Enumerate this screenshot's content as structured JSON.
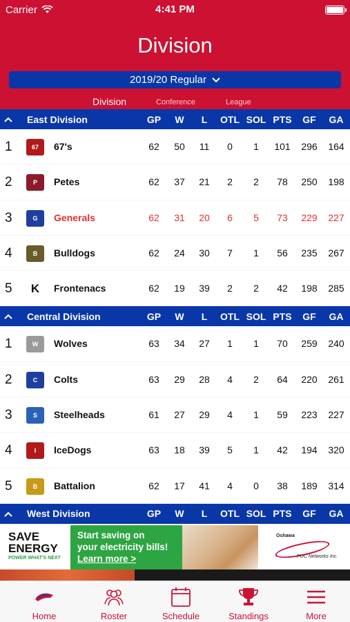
{
  "status": {
    "carrier": "Carrier",
    "time": "4:41 PM"
  },
  "header": {
    "title": "Division",
    "season": "2019/20 Regular"
  },
  "tabs": [
    {
      "label": "Division"
    },
    {
      "label": "Conference"
    },
    {
      "label": "League"
    }
  ],
  "columns": [
    "GP",
    "W",
    "L",
    "OTL",
    "SOL",
    "PTS",
    "GF",
    "GA"
  ],
  "divisions": [
    {
      "name": "East Division",
      "teams": [
        {
          "rank": "1",
          "team": "67's",
          "logo_color": "#b01a1a",
          "logo_text": "67",
          "gp": "62",
          "w": "50",
          "l": "11",
          "otl": "0",
          "sol": "1",
          "pts": "101",
          "gf": "296",
          "ga": "164"
        },
        {
          "rank": "2",
          "team": "Petes",
          "logo_color": "#8b1a2b",
          "logo_text": "P",
          "gp": "62",
          "w": "37",
          "l": "21",
          "otl": "2",
          "sol": "2",
          "pts": "78",
          "gf": "250",
          "ga": "198"
        },
        {
          "rank": "3",
          "team": "Generals",
          "logo_color": "#1f3fa0",
          "logo_text": "G",
          "gp": "62",
          "w": "31",
          "l": "20",
          "otl": "6",
          "sol": "5",
          "pts": "73",
          "gf": "229",
          "ga": "227"
        },
        {
          "rank": "4",
          "team": "Bulldogs",
          "logo_color": "#6b5a2a",
          "logo_text": "B",
          "gp": "62",
          "w": "24",
          "l": "30",
          "otl": "7",
          "sol": "1",
          "pts": "56",
          "gf": "235",
          "ga": "267"
        },
        {
          "rank": "5",
          "team": "Frontenacs",
          "logo_color": "#f2c300",
          "logo_text": "K",
          "gp": "62",
          "w": "19",
          "l": "39",
          "otl": "2",
          "sol": "2",
          "pts": "42",
          "gf": "198",
          "ga": "285"
        }
      ]
    },
    {
      "name": "Central Division",
      "teams": [
        {
          "rank": "1",
          "team": "Wolves",
          "logo_color": "#9a9a9a",
          "logo_text": "W",
          "gp": "63",
          "w": "34",
          "l": "27",
          "otl": "1",
          "sol": "1",
          "pts": "70",
          "gf": "259",
          "ga": "240"
        },
        {
          "rank": "2",
          "team": "Colts",
          "logo_color": "#1f3fa0",
          "logo_text": "C",
          "gp": "63",
          "w": "29",
          "l": "28",
          "otl": "4",
          "sol": "2",
          "pts": "64",
          "gf": "220",
          "ga": "261"
        },
        {
          "rank": "3",
          "team": "Steelheads",
          "logo_color": "#2a62b8",
          "logo_text": "S",
          "gp": "61",
          "w": "27",
          "l": "29",
          "otl": "4",
          "sol": "1",
          "pts": "59",
          "gf": "223",
          "ga": "227"
        },
        {
          "rank": "4",
          "team": "IceDogs",
          "logo_color": "#b01a1a",
          "logo_text": "I",
          "gp": "63",
          "w": "18",
          "l": "39",
          "otl": "5",
          "sol": "1",
          "pts": "42",
          "gf": "194",
          "ga": "320"
        },
        {
          "rank": "5",
          "team": "Battalion",
          "logo_color": "#c79a1a",
          "logo_text": "B",
          "gp": "62",
          "w": "17",
          "l": "41",
          "otl": "4",
          "sol": "0",
          "pts": "38",
          "gf": "189",
          "ga": "314"
        }
      ]
    },
    {
      "name": "West Division",
      "teams": []
    }
  ],
  "ad": {
    "brand_line1": "SAVE",
    "brand_line2": "ENERGY",
    "brand_tagline": "POWER WHAT'S NEXT",
    "cta_line1": "Start saving on",
    "cta_line2": "your electricity bills!",
    "cta_link": "Learn more >",
    "sponsor_top": "Oshawa",
    "sponsor_bottom": "PUC Networks Inc."
  },
  "tabbar": [
    {
      "label": "Home"
    },
    {
      "label": "Roster"
    },
    {
      "label": "Schedule"
    },
    {
      "label": "Standings"
    },
    {
      "label": "More"
    }
  ],
  "colors": {
    "primary_red": "#cc1133",
    "primary_blue": "#0a37a8",
    "highlight_text": "#e03030"
  }
}
